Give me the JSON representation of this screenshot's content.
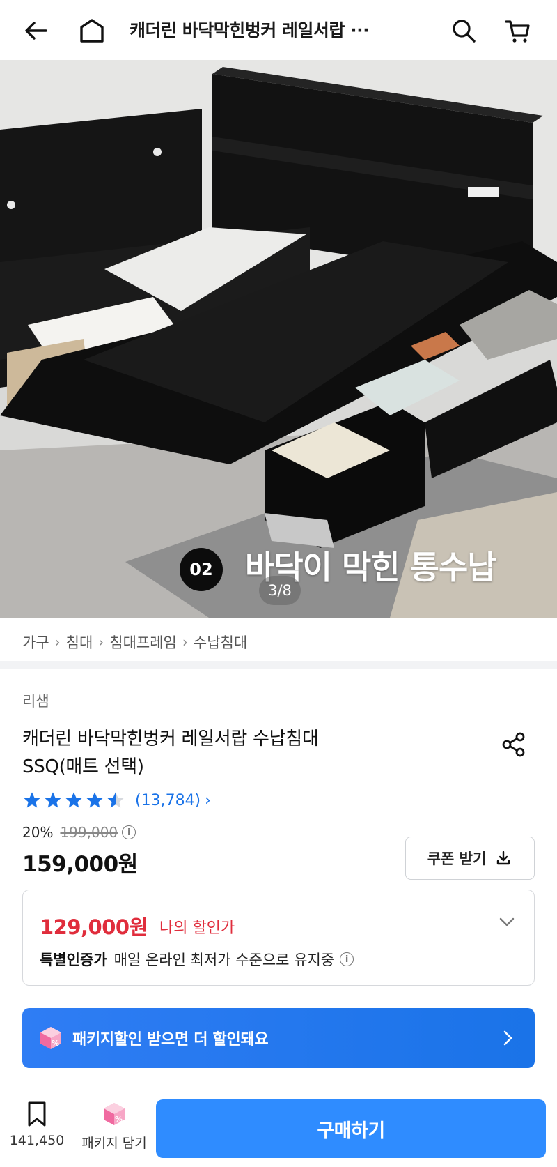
{
  "header": {
    "title": "캐더린 바닥막힌벙커 레일서랍 ···",
    "back_icon": "arrow-left-icon",
    "home_icon": "home-icon",
    "search_icon": "search-icon",
    "cart_icon": "cart-icon"
  },
  "hero": {
    "badge": "02",
    "caption": "바닥이 막힌 통수납",
    "counter": "3/8"
  },
  "breadcrumb": [
    "가구",
    "침대",
    "침대프레임",
    "수납침대"
  ],
  "product": {
    "brand": "리샘",
    "title_line1": "캐더린 바닥막힌벙커 레일서랍 수납침대",
    "title_line2": "SSQ(매트 선택)",
    "rating": 4.5,
    "review_count": "(13,784)",
    "discount_pct": "20%",
    "original_price": "199,000",
    "sale_price": "159,000원"
  },
  "coupon": {
    "label": "쿠폰 받기"
  },
  "my_discount": {
    "price": "129,000원",
    "label": "나의 할인가",
    "cert_bold": "특별인증가",
    "cert_text": "매일 온라인 최저가 수준으로 유지중"
  },
  "package_banner": {
    "text": "패키지할인 받으면 더 할인돼요"
  },
  "bottom": {
    "wishlist_count": "141,450",
    "package_label": "패키지 담기",
    "buy_label": "구매하기"
  },
  "colors": {
    "accent_blue": "#2f8cff",
    "discount_red": "#e02d3c",
    "star_blue": "#1a73e8",
    "package_pink": "#f06aa0"
  }
}
